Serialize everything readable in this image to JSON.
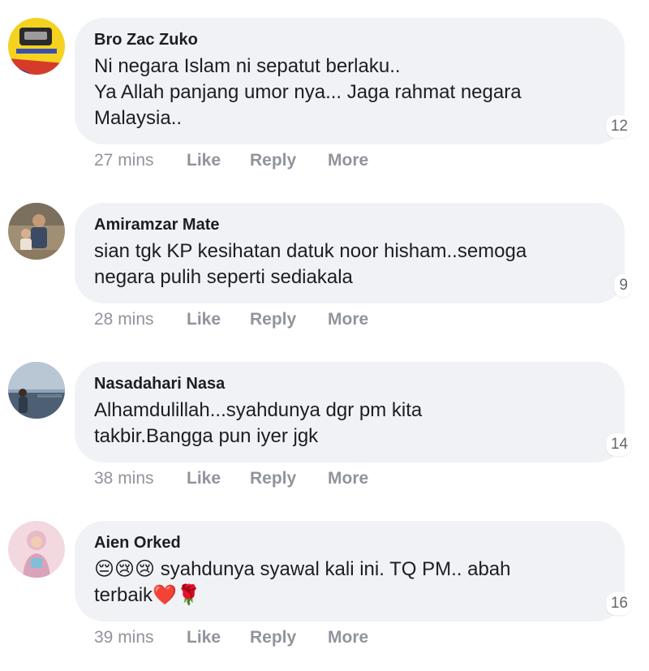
{
  "comments": [
    {
      "author": "Bro Zac Zuko",
      "lines": [
        "Ni negara Islam ni sepatut berlaku..",
        "Ya Allah panjang umor nya... Jaga rahmat negara",
        "Malaysia.."
      ],
      "reactions": "12",
      "time": "27 mins",
      "avatar_icon": "yellow-logo-avatar"
    },
    {
      "author": "Amiramzar Mate",
      "lines": [
        "sian tgk KP kesihatan datuk noor hisham..semoga",
        "negara pulih seperti sediakala"
      ],
      "reactions": "9",
      "time": "28 mins",
      "avatar_icon": "family-photo-avatar"
    },
    {
      "author": "Nasadahari Nasa",
      "lines": [
        "Alhamdulillah...syahdunya dgr pm kita",
        "takbir.Bangga pun iyer jgk"
      ],
      "reactions": "14",
      "time": "38 mins",
      "avatar_icon": "landscape-photo-avatar"
    },
    {
      "author": "Aien Orked",
      "lines": [
        "😔😢😢 syahdunya syawal kali ini. TQ PM.. abah",
        "terbaik❤️🌹"
      ],
      "reactions": "16",
      "time": "39 mins",
      "avatar_icon": "pink-portrait-avatar"
    }
  ],
  "actions": {
    "like": "Like",
    "reply": "Reply",
    "more": "More"
  },
  "colors": {
    "bubble": "#f0f2f5",
    "meta": "#90949c",
    "text": "#1c1e21"
  }
}
